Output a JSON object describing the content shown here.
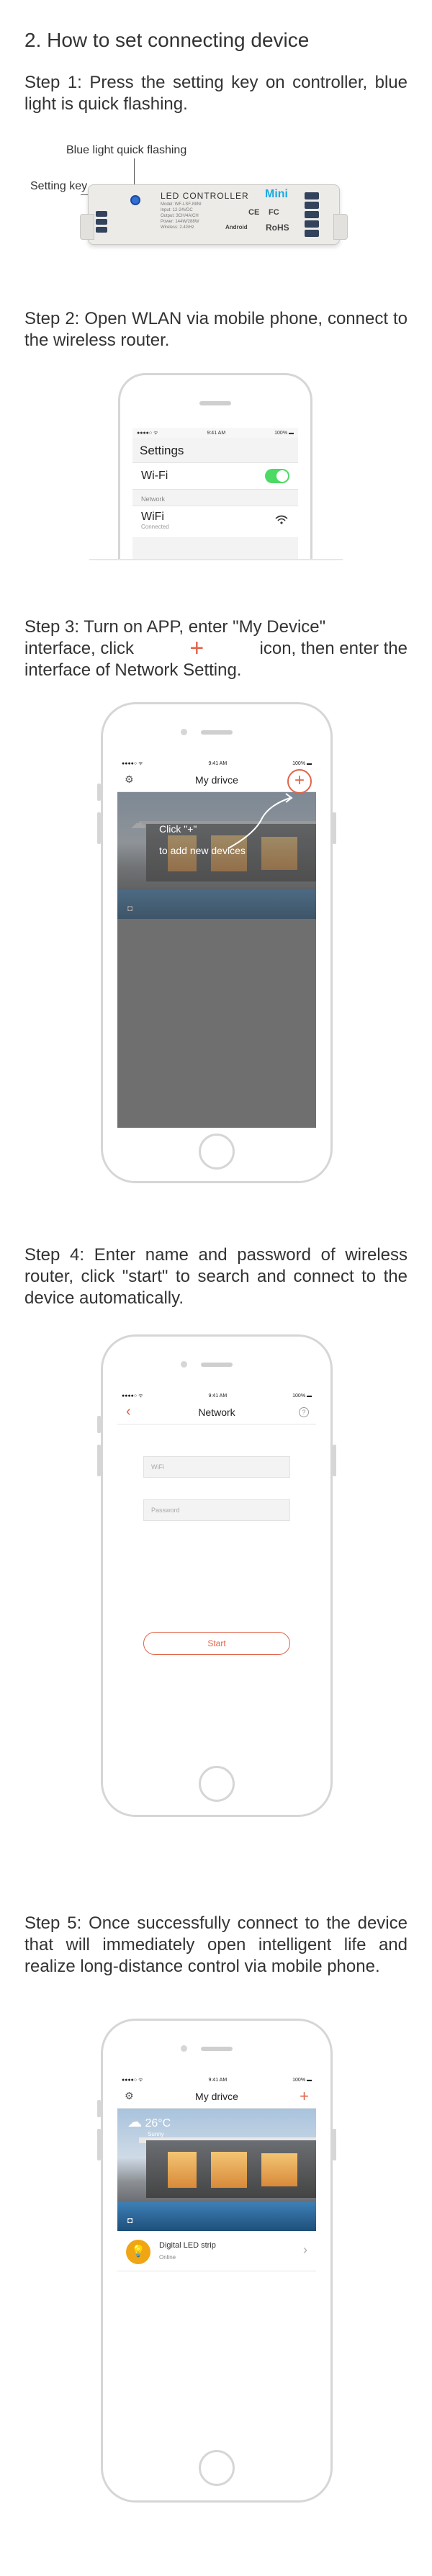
{
  "heading": "2. How to set connecting device",
  "steps": {
    "s1": "Step 1: Press the setting key on controller, blue light is quick flashing.",
    "s2": "Step 2: Open WLAN via mobile phone, connect to the wireless router.",
    "s3a": "Step 3: Turn on APP, enter \"My Device\"",
    "s3b_pre": "interface, click",
    "s3b_post": "icon, then enter the",
    "s3c": "interface of Network Setting.",
    "s4": "Step 4: Enter name and password of wireless router, click \"start\" to search and connect to the device automatically.",
    "s5": "Step 5: Once successfully connect to the device that will immediately open intelligent life and realize long-distance control via mobile phone."
  },
  "controller": {
    "blue_light_label": "Blue light quick flashing",
    "setting_key_label": "Setting key",
    "title": "LED CONTROLLER",
    "mini": "Mini",
    "marks": [
      "CE",
      "FC",
      "RoHS",
      "Android"
    ],
    "fine_print": [
      "Model: WF-LSF-MINI",
      "Input: 12-24VDC",
      "Output: 3CH/4A/CH",
      "Power: 144W/288W",
      "Wireless: 2.4GHz"
    ]
  },
  "status_bar": {
    "left": "●●●●○ ᯤ",
    "time": "9:41 AM",
    "battery": "100% ▬"
  },
  "settings_screen": {
    "title": "Settings",
    "wifi_label": "Wi-Fi",
    "section": "Network",
    "network_name": "WiFi",
    "network_status": "Connected"
  },
  "app": {
    "my_device_title": "My drivce",
    "hint_line1": "Click \"+\"",
    "hint_line2": "to add new devices",
    "network_title": "Network",
    "wifi_placeholder": "WiFi",
    "password_placeholder": "Password",
    "start_label": "Start",
    "weather_temp": "26°C",
    "weather_desc": "Sunny",
    "device_name": "Digital LED strip",
    "device_status": "Online"
  },
  "colors": {
    "accent": "#e2634a",
    "toggle": "#4cd964",
    "device_icon": "#f0a514",
    "mini": "#1aa9e1"
  },
  "icons": [
    "gear-icon",
    "plus-icon",
    "back-icon",
    "help-icon",
    "wifi-icon",
    "chevron-right-icon",
    "bulb-icon",
    "cloud-icon",
    "camera-icon"
  ]
}
